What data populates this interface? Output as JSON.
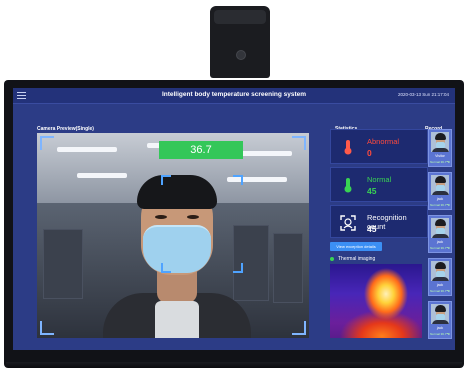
{
  "app": {
    "title": "Intelligent body temperature screening system",
    "datetime": "2020-03-13 Sun 21:17:04"
  },
  "preview": {
    "label": "Camera Preview(Single)",
    "temperature": "36.7"
  },
  "statistics": {
    "label": "Statistics",
    "items": [
      {
        "label": "Abnormal",
        "value": "0",
        "color": "#ff4a3d",
        "icon": "thermometer-icon"
      },
      {
        "label": "Normal",
        "value": "45",
        "color": "#39d353",
        "icon": "thermometer-icon"
      },
      {
        "label": "Recognition count",
        "value": "45",
        "color": "#ffffff",
        "icon": "face-scan-icon"
      }
    ],
    "exception_button": "View exception details",
    "thermal_label": "Thermal imaging"
  },
  "record": {
    "label": "Record",
    "items": [
      {
        "name": "Visitor",
        "temp": "Normal 36.7℃"
      },
      {
        "name": "jack",
        "temp": "Normal 36.7℃"
      },
      {
        "name": "jack",
        "temp": "Normal 36.7℃"
      },
      {
        "name": "jack",
        "temp": "Normal 36.7℃"
      },
      {
        "name": "jack",
        "temp": "Normal 36.7℃"
      }
    ]
  }
}
